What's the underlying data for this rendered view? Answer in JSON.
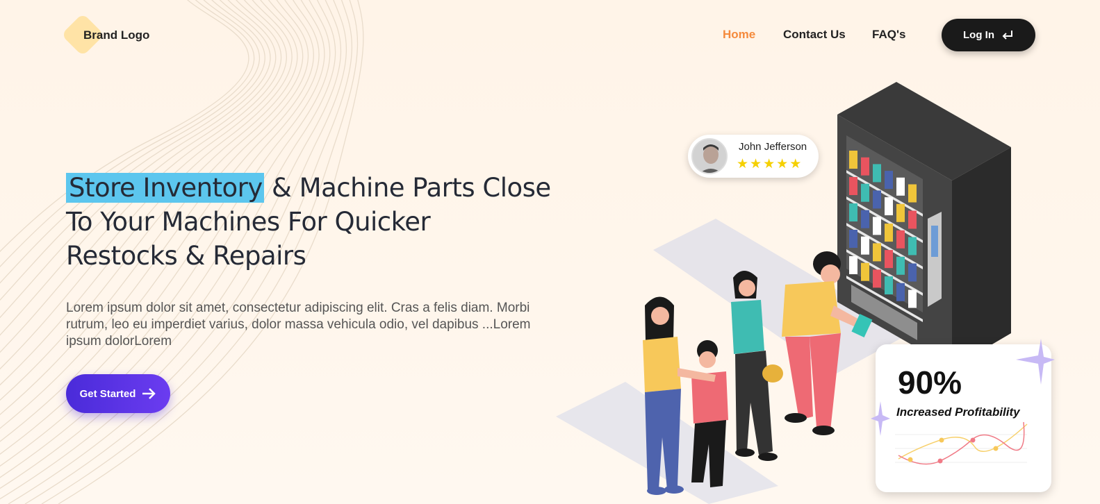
{
  "header": {
    "brand": "Brand Logo",
    "nav": [
      {
        "label": "Home",
        "active": true
      },
      {
        "label": "Contact Us",
        "active": false
      },
      {
        "label": "FAQ's",
        "active": false
      }
    ],
    "login_label": "Log In",
    "login_icon": "enter-arrow-icon"
  },
  "hero": {
    "headline_highlight": "Store Inventory",
    "headline_line1_rest": " & Machine Parts Close",
    "headline_line2": "To Your Machines For Quicker",
    "headline_line3": "Restocks & Repairs",
    "description": "Lorem ipsum dolor sit amet, consectetur adipiscing elit. Cras a felis diam. Morbi rutrum, leo eu imperdiet varius, dolor massa vehicula odio, vel dapibus ...Lorem ipsum dolorLorem",
    "cta_label": "Get Started",
    "cta_icon": "arrow-right-icon"
  },
  "review": {
    "name": "John Jefferson",
    "rating": 5,
    "stars": [
      "★",
      "★",
      "★",
      "★",
      "★"
    ]
  },
  "stat": {
    "value": "90%",
    "label": "Increased Profitability"
  },
  "colors": {
    "accent_orange": "#f58a3c",
    "highlight_blue": "#5cc6ee",
    "cta_purple": "#4a2bd9",
    "dark_button": "#1a1a1a",
    "star_yellow": "#f5d000"
  }
}
